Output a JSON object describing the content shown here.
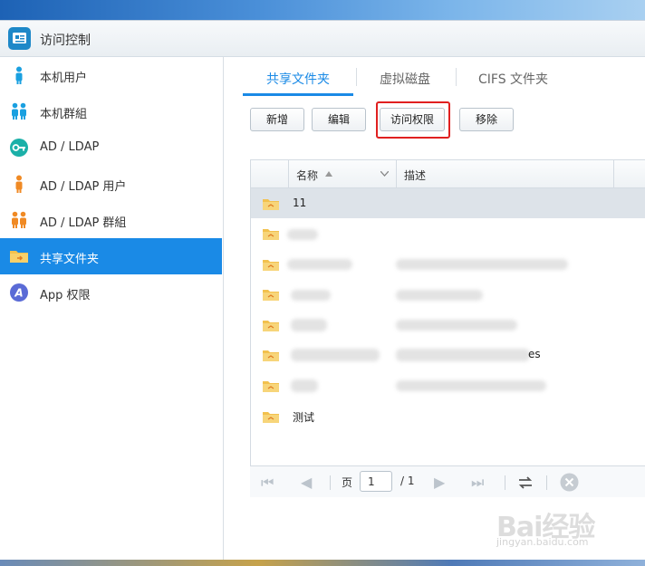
{
  "window": {
    "title": "访问控制"
  },
  "sidebar": {
    "items": [
      {
        "label": "本机用户",
        "icon": "user-icon",
        "active": false
      },
      {
        "label": "本机群組",
        "icon": "group-icon",
        "active": false
      },
      {
        "label": "AD / LDAP",
        "icon": "key-icon",
        "active": false
      },
      {
        "label": "AD / LDAP 用户",
        "icon": "ldap-user-icon",
        "active": false
      },
      {
        "label": "AD / LDAP 群組",
        "icon": "ldap-group-icon",
        "active": false
      },
      {
        "label": "共享文件夹",
        "icon": "shared-folder-icon",
        "active": true
      },
      {
        "label": "App 权限",
        "icon": "app-permission-icon",
        "active": false
      }
    ]
  },
  "tabs": [
    {
      "label": "共享文件夹",
      "active": true
    },
    {
      "label": "虚拟磁盘",
      "active": false
    },
    {
      "label": "CIFS 文件夹",
      "active": false
    }
  ],
  "toolbar": {
    "add": "新增",
    "edit": "编辑",
    "access": "访问权限",
    "remove": "移除"
  },
  "table": {
    "columns": [
      "名称",
      "描述"
    ],
    "rows": [
      {
        "name": "11",
        "desc": "",
        "selected": true
      },
      {
        "name": "",
        "desc": "",
        "selected": false
      },
      {
        "name": "",
        "desc": "",
        "selected": false
      },
      {
        "name": "",
        "desc": "",
        "selected": false
      },
      {
        "name": "",
        "desc": "",
        "selected": false
      },
      {
        "name": "",
        "desc": "es",
        "selected": false
      },
      {
        "name": "",
        "desc": "",
        "selected": false
      },
      {
        "name": "测试",
        "desc": "",
        "selected": false
      }
    ]
  },
  "pager": {
    "page_label": "页",
    "page_value": "1",
    "total": "/ 1"
  },
  "watermark": {
    "text": "Bai经验",
    "sub": "jingyan.baidu.com"
  },
  "colors": {
    "accent": "#1a8ae6",
    "highlight": "#e02020",
    "folder": "#f2c14e"
  }
}
